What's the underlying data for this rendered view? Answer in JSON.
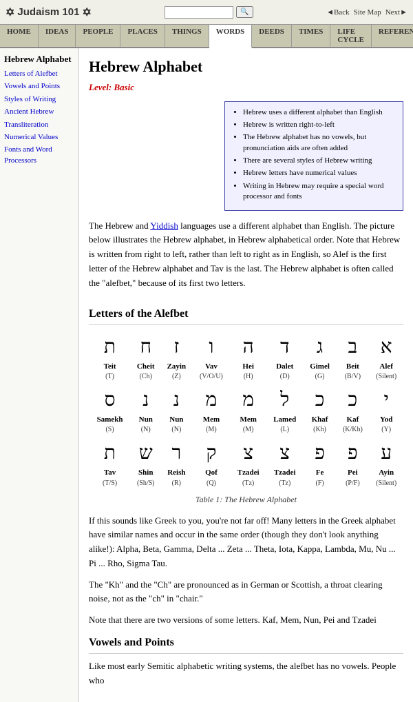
{
  "site": {
    "title": "Judaism 101",
    "logo_star": "✡"
  },
  "topbar": {
    "back": "◄Back",
    "sitemap": "Site Map",
    "next": "Next►"
  },
  "search": {
    "placeholder": ""
  },
  "nav": {
    "items": [
      "HOME",
      "IDEAS",
      "PEOPLE",
      "PLACES",
      "THINGS",
      "WORDS",
      "DEEDS",
      "TIMES",
      "LIFE CYCLE",
      "REFERENCE"
    ],
    "active": "WORDS"
  },
  "sidebar": {
    "heading": "Hebrew Alphabet",
    "links": [
      "Letters of Alefbet",
      "Vowels and Points",
      "Styles of Writing",
      "Ancient Hebrew",
      "Transliteration",
      "Numerical Values",
      "Fonts and Word Processors"
    ]
  },
  "page": {
    "title": "Hebrew Alphabet",
    "level": "Basic",
    "level_label": "Level:"
  },
  "infobox": {
    "items": [
      "Hebrew uses a different alphabet than English",
      "Hebrew is written right-to-left",
      "The Hebrew alphabet has no vowels, but pronunciation aids are often added",
      "There are several styles of Hebrew writing",
      "Hebrew letters have numerical values",
      "Writing in Hebrew may require a special word processor and fonts"
    ]
  },
  "intro": {
    "text1": "The Hebrew and ",
    "yiddish_link": "Yiddish",
    "text2": " languages use a different alphabet than English. The picture below illustrates the Hebrew alphabet, in Hebrew alphabetical order. Note that Hebrew is written from right to left, rather than left to right as in English, so Alef is the first letter of the Hebrew alphabet and Tav is the last. The Hebrew alphabet is often called the \"alefbet,\" because of its first two letters."
  },
  "alefbet": {
    "section_title": "Letters of the Alefbet",
    "table_caption": "Table 1: The Hebrew Alphabet",
    "rows": [
      {
        "letters": [
          {
            "char": "ת",
            "name": "Teit",
            "trans": "(T)"
          },
          {
            "char": "ח",
            "name": "Cheit",
            "trans": "(Ch)"
          },
          {
            "char": "ז",
            "name": "Zayin",
            "trans": "(Z)"
          },
          {
            "char": "ו",
            "name": "Vav",
            "trans": "(V/O/U)"
          },
          {
            "char": "ה",
            "name": "Hei",
            "trans": "(H)"
          },
          {
            "char": "ד",
            "name": "Dalet",
            "trans": "(D)"
          },
          {
            "char": "ג",
            "name": "Gimel",
            "trans": "(G)"
          },
          {
            "char": "ב",
            "name": "Beit",
            "trans": "(B/V)"
          },
          {
            "char": "א",
            "name": "Alef",
            "trans": "(Silent)"
          }
        ]
      },
      {
        "letters": [
          {
            "char": "ס",
            "name": "Samekh",
            "trans": "(S)"
          },
          {
            "char": "נ",
            "name": "Nun",
            "trans": "(N)"
          },
          {
            "char": "נ",
            "name": "Nun",
            "trans": "(N)"
          },
          {
            "char": "מ",
            "name": "Mem",
            "trans": "(M)"
          },
          {
            "char": "מ",
            "name": "Mem",
            "trans": "(M)"
          },
          {
            "char": "ל",
            "name": "Lamed",
            "trans": "(L)"
          },
          {
            "char": "כ",
            "name": "Khaf",
            "trans": "(Kh)"
          },
          {
            "char": "כ",
            "name": "Kaf",
            "trans": "(K/Kh)"
          },
          {
            "char": "י",
            "name": "Yod",
            "trans": "(Y)"
          }
        ]
      },
      {
        "letters": [
          {
            "char": "ת",
            "name": "Tav",
            "trans": "(T/S)"
          },
          {
            "char": "ש",
            "name": "Shin",
            "trans": "(Sh/S)"
          },
          {
            "char": "ר",
            "name": "Reish",
            "trans": "(R)"
          },
          {
            "char": "ק",
            "name": "Qof",
            "trans": "(Q)"
          },
          {
            "char": "צ",
            "name": "Tzadei",
            "trans": "(Tz)"
          },
          {
            "char": "צ",
            "name": "Tzadei",
            "trans": "(Tz)"
          },
          {
            "char": "פ",
            "name": "Fe",
            "trans": "(F)"
          },
          {
            "char": "פ",
            "name": "Pei",
            "trans": "(P/F)"
          },
          {
            "char": "ע",
            "name": "Ayin",
            "trans": "(Silent)"
          }
        ]
      }
    ]
  },
  "body_paragraphs": [
    "If this sounds like Greek to you, you're not far off! Many letters in the Greek alphabet have similar names and occur in the same order (though they don't look anything alike!): Alpha, Beta, Gamma, Delta ... Zeta ... Theta, Iota, Kappa, Lambda, Mu, Nu ... Pi ... Rho, Sigma Tau.",
    "The \"Kh\" and the \"Ch\" are pronounced as in German or Scottish, a throat clearing noise, not as the \"ch\" in \"chair.\"",
    "Note that there are two versions of some letters. Kaf, Mem, Nun, Pei and Tzadei",
    "Vowels and Points",
    "Like most early Semitic alphabetic writing systems, the alefbet has no vowels. People who"
  ],
  "vowels_section_title": "Vowels and Points",
  "vowels_intro": "Like most early Semitic alphabetic writing systems, the alefbet has no vowels. People who"
}
